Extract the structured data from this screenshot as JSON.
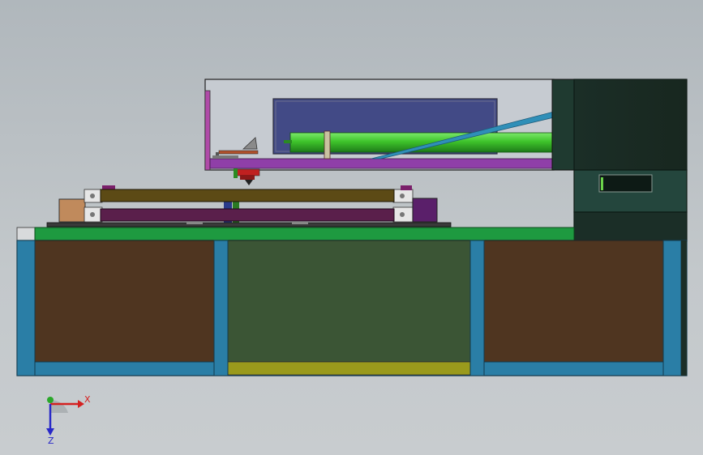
{
  "viewport": {
    "view": "front-view",
    "colors": {
      "background": "#bdc2c6",
      "frame_blue": "#2a7ea6",
      "panel_brown": "#4f3520",
      "panel_green": "#3b5535",
      "table_top": "#1e9a40",
      "base_strip": "#9a9a1c",
      "cabinet": "#1b2e27",
      "rail_gold": "#5c4a15",
      "rail_purple": "#5a1f4b",
      "roller_green": "#3ec42b",
      "enclosure_purple": "#8f3fa8"
    }
  },
  "triad": {
    "x_label": "X",
    "z_label": "Z",
    "x_color": "#d42020",
    "y_color": "#2aa82a",
    "z_color": "#2828c8"
  }
}
